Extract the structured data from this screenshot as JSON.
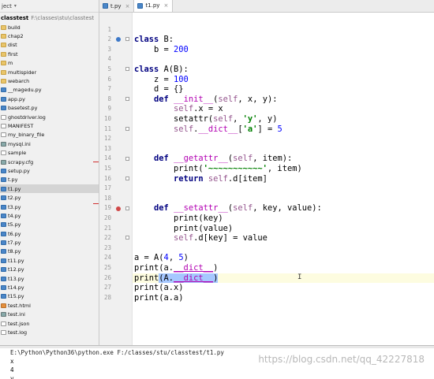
{
  "project": {
    "header": "ject",
    "root_name": "classtest",
    "root_path": "F:\\classes\\stu\\classtest",
    "items": [
      {
        "label": "build",
        "kind": "folder"
      },
      {
        "label": "chap2",
        "kind": "folder"
      },
      {
        "label": "dist",
        "kind": "folder"
      },
      {
        "label": "first",
        "kind": "folder"
      },
      {
        "label": "m",
        "kind": "folder"
      },
      {
        "label": "multispider",
        "kind": "folder"
      },
      {
        "label": "webarch",
        "kind": "folder"
      },
      {
        "label": "__magedu.py",
        "kind": "py"
      },
      {
        "label": "app.py",
        "kind": "py"
      },
      {
        "label": "basetest.py",
        "kind": "py"
      },
      {
        "label": "ghostdriver.log",
        "kind": "file"
      },
      {
        "label": "MANIFEST",
        "kind": "file"
      },
      {
        "label": "my_binary_file",
        "kind": "file"
      },
      {
        "label": "mysql.ini",
        "kind": "cfg"
      },
      {
        "label": "sample",
        "kind": "file"
      },
      {
        "label": "scrapy.cfg",
        "kind": "cfg"
      },
      {
        "label": "setup.py",
        "kind": "py"
      },
      {
        "label": "t.py",
        "kind": "py"
      },
      {
        "label": "t1.py",
        "kind": "py",
        "selected": true
      },
      {
        "label": "t2.py",
        "kind": "py"
      },
      {
        "label": "t3.py",
        "kind": "py"
      },
      {
        "label": "t4.py",
        "kind": "py"
      },
      {
        "label": "t5.py",
        "kind": "py"
      },
      {
        "label": "t6.py",
        "kind": "py"
      },
      {
        "label": "t7.py",
        "kind": "py"
      },
      {
        "label": "t8.py",
        "kind": "py"
      },
      {
        "label": "t11.py",
        "kind": "py"
      },
      {
        "label": "t12.py",
        "kind": "py"
      },
      {
        "label": "t13.py",
        "kind": "py"
      },
      {
        "label": "t14.py",
        "kind": "py"
      },
      {
        "label": "t15.py",
        "kind": "py"
      },
      {
        "label": "test.html",
        "kind": "html"
      },
      {
        "label": "test.ini",
        "kind": "cfg"
      },
      {
        "label": "test.json",
        "kind": "file"
      },
      {
        "label": "test.log",
        "kind": "file"
      }
    ]
  },
  "tabs": [
    {
      "label": "t.py",
      "close": "×",
      "active": false
    },
    {
      "label": "t1.py",
      "close": "×",
      "active": true
    }
  ],
  "editor": {
    "current_line": 26,
    "lines": [
      {
        "n": "1",
        "html": ""
      },
      {
        "n": "2",
        "html": "<span class=\"kw\">class</span> B:"
      },
      {
        "n": "3",
        "html": "    b = <span class=\"num\">200</span>"
      },
      {
        "n": "4",
        "html": ""
      },
      {
        "n": "5",
        "html": "<span class=\"kw\">class</span> A(B):"
      },
      {
        "n": "6",
        "html": "    z = <span class=\"num\">100</span>"
      },
      {
        "n": "7",
        "html": "    d = {}"
      },
      {
        "n": "8",
        "html": "    <span class=\"kw\">def</span> <span class=\"magic\">__init__</span>(<span class=\"self\">self</span>, x, y):"
      },
      {
        "n": "9",
        "html": "        <span class=\"self\">self</span>.x = x"
      },
      {
        "n": "10",
        "html": "        setattr(<span class=\"self\">self</span>, <span class=\"str\">'y'</span>, y)"
      },
      {
        "n": "11",
        "html": "        <span class=\"self\">self</span>.<span class=\"magic\">__dict__</span>[<span class=\"str\">'a'</span>] = <span class=\"num\">5</span>"
      },
      {
        "n": "12",
        "html": ""
      },
      {
        "n": "13",
        "html": ""
      },
      {
        "n": "14",
        "html": "    <span class=\"kw\">def</span> <span class=\"magic\">__getattr__</span>(<span class=\"self\">self</span>, item):"
      },
      {
        "n": "15",
        "html": "        print(<span class=\"str\">'~~~~~~~~~~~'</span>, item)"
      },
      {
        "n": "16",
        "html": "        <span class=\"kw\">return</span> <span class=\"self\">self</span>.d[item]"
      },
      {
        "n": "17",
        "html": ""
      },
      {
        "n": "18",
        "html": ""
      },
      {
        "n": "19",
        "html": "    <span class=\"kw\">def</span> <span class=\"magic\">__setattr__</span>(<span class=\"self\">self</span>, key, value):"
      },
      {
        "n": "20",
        "html": "        print(key)"
      },
      {
        "n": "21",
        "html": "        print(value)"
      },
      {
        "n": "22",
        "html": "        <span class=\"self\">self</span>.d[key] = value"
      },
      {
        "n": "23",
        "html": ""
      },
      {
        "n": "24",
        "html": "a = A(<span class=\"num\">4</span>, <span class=\"num\">5</span>)"
      },
      {
        "n": "25",
        "html": "print(a.<span class=\"magic-call\">__dict__</span>)"
      },
      {
        "n": "26",
        "html": "print<span class=\"sel\">(A.<span class=\"magic-call\">__dict__</span>)</span>"
      },
      {
        "n": "27",
        "html": "print(a.x)"
      },
      {
        "n": "28",
        "html": "print(a.a)"
      }
    ],
    "text_cursor": "I"
  },
  "console": {
    "lines": [
      "E:\\Python\\Python36\\python.exe F:/classes/stu/classtest/t1.py",
      "x",
      "4",
      "y"
    ],
    "watermark": "https://blog.csdn.net/qq_42227818"
  }
}
